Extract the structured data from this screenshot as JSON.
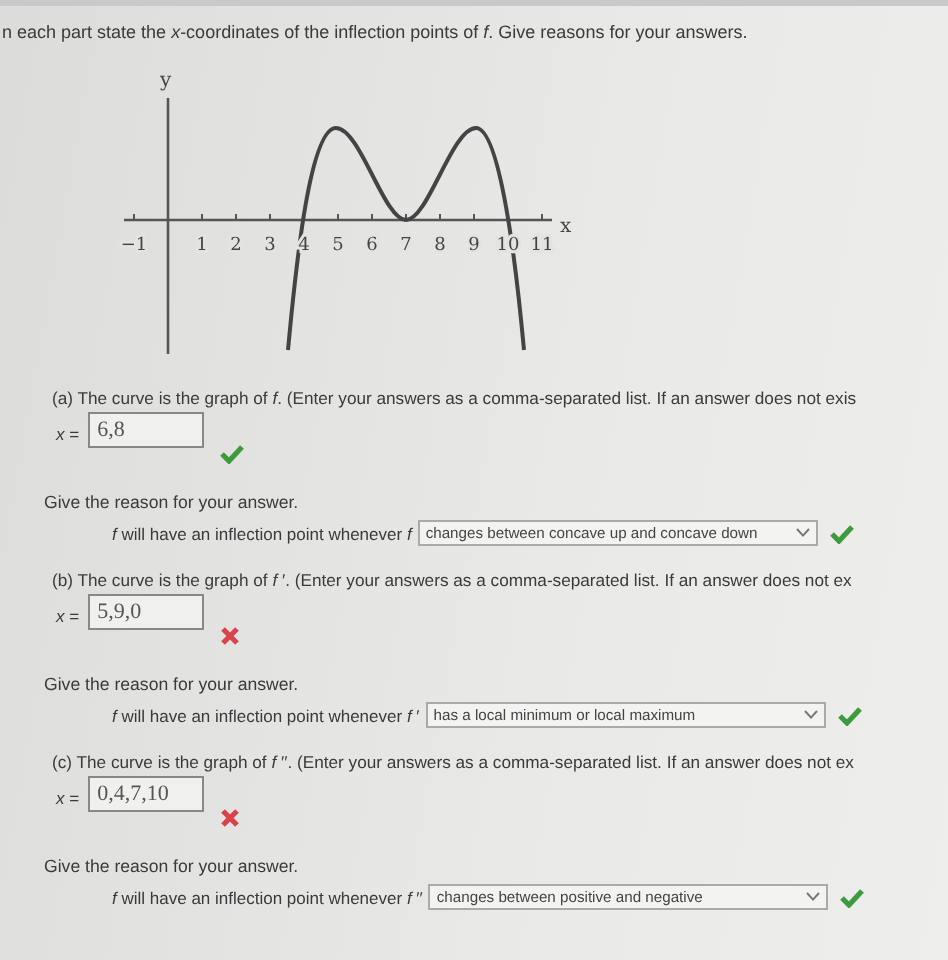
{
  "instructions": "n each part state the *x*-coordinates of the inflection points of *f*. Give reasons for your answers.",
  "graph": {
    "y_label": "y",
    "x_label": "x",
    "x_tick_labels": [
      "−1",
      "1",
      "2",
      "3",
      "4",
      "5",
      "6",
      "7",
      "8",
      "9",
      "10",
      "11"
    ]
  },
  "parts": [
    {
      "prompt": "(a) The curve is the graph of *f*. (Enter your answers as a comma-separated list. If an answer does not exis",
      "answer_label": "*x* =",
      "answer": "6,8",
      "answer_correct": true,
      "reason_heading": "Give the reason for your answer.",
      "reason_text": "*f* will have an inflection point whenever *f*",
      "reason_choice": "changes between concave up and concave down",
      "reason_correct": true
    },
    {
      "prompt": "(b) The curve is the graph of *f* ′. (Enter your answers as a comma-separated list. If an answer does not ex",
      "answer_label": "*x* =",
      "answer": "5,9,0",
      "answer_correct": false,
      "reason_heading": "Give the reason for your answer.",
      "reason_text": "*f* will have an inflection point whenever *f* ′",
      "reason_choice": "has a local minimum or local maximum",
      "reason_correct": true
    },
    {
      "prompt": "(c) The curve is the graph of *f* ′′. (Enter your answers as a comma-separated list. If an answer does not ex",
      "answer_label": "*x* =",
      "answer": "0,4,7,10",
      "answer_correct": false,
      "reason_heading": "Give the reason for your answer.",
      "reason_text": "*f* will have an inflection point whenever *f* ′′",
      "reason_choice": "changes between positive and negative",
      "reason_correct": true
    }
  ]
}
